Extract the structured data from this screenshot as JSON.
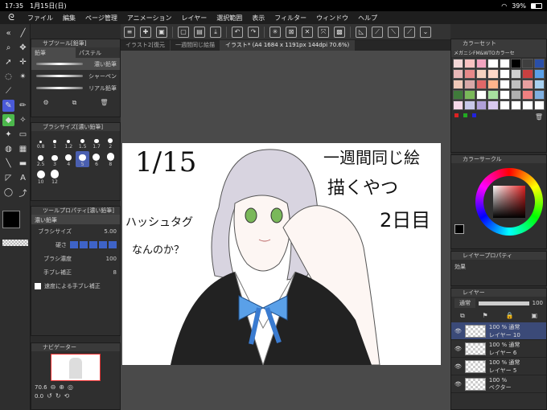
{
  "status_bar": {
    "time": "17:35",
    "date": "1月15日(日)",
    "battery": "39%"
  },
  "menu": {
    "items": [
      "ファイル",
      "編集",
      "ページ管理",
      "アニメーション",
      "レイヤー",
      "選択範囲",
      "表示",
      "フィルター",
      "ウィンドウ",
      "ヘルプ"
    ]
  },
  "tabs": [
    {
      "label": "イラスト2[復元"
    },
    {
      "label": "一週間同じ絵描"
    },
    {
      "label": "イラスト* (A4 1684 x 1191px 144dpi 70.6%)"
    }
  ],
  "subtool_panel": {
    "title": "サブツール[鉛筆]",
    "tab_pencil": "鉛筆",
    "tab_pastel": "パステル",
    "brushes": [
      "濃い鉛筆",
      "シャーペン",
      "リアル鉛筆"
    ]
  },
  "brush_size_panel": {
    "title": "ブラシサイズ[濃い鉛筆]",
    "sizes": [
      "0.8",
      "1",
      "1.2",
      "1.5",
      "1.7",
      "2",
      "2.5",
      "3",
      "4",
      "5",
      "6",
      "8",
      "10",
      "12"
    ]
  },
  "tool_property": {
    "title": "ツールプロパティ[濃い鉛筆]",
    "brush_name": "濃い鉛筆",
    "brush_size_label": "ブラシサイズ",
    "brush_size_value": "5.00",
    "hardness_label": "硬さ",
    "density_label": "ブラシ濃度",
    "density_value": "100",
    "stabilization_label": "手ブレ補正",
    "stabilization_value": "8",
    "speed_stabilization_label": "速度による手ブレ補正"
  },
  "navigator": {
    "title": "ナビゲーター",
    "zoom": "70.6",
    "rotation": "0.0"
  },
  "color_set": {
    "title": "カラーセット",
    "set_name": "メガニシFM&WTOカラーセ",
    "swatches": [
      "#f2d6d6",
      "#f8c2c2",
      "#f2a4c0",
      "#ffffff",
      "#ffffff",
      "#000000",
      "#3f3f3f",
      "#2a4fa8",
      "#e8b8b8",
      "#e88a8a",
      "#f5d2c0",
      "#ffd8c8",
      "#ffffff",
      "#d0d0d0",
      "#c84040",
      "#5aa0e8",
      "#f0c8b8",
      "#d8a8a8",
      "#e06868",
      "#ffb48c",
      "#ffffff",
      "#c0c0c0",
      "#e8a0a0",
      "#a8d0f0",
      "#3f7a3a",
      "#7ab85a",
      "#ffffff",
      "#a8e0a0",
      "#ffffff",
      "#b0b0b0",
      "#f08080",
      "#80b0e0",
      "#f5d8e8",
      "#c8c8e8",
      "#b0a0d8",
      "#d8c8f0",
      "#ffffff",
      "#ffffff",
      "#ffffff",
      "#ffffff"
    ]
  },
  "color_wheel": {
    "title": "カラーサークル"
  },
  "layer_property": {
    "title": "レイヤープロパティ",
    "effect_label": "効果"
  },
  "layers": {
    "title": "レイヤー",
    "blend": "通常",
    "opacity": "100",
    "items": [
      {
        "opacity": "100 %",
        "blend": "通常",
        "name": "レイヤー 10"
      },
      {
        "opacity": "100 %",
        "blend": "通常",
        "name": "レイヤー 6"
      },
      {
        "opacity": "100 %",
        "blend": "通常",
        "name": "レイヤー 5"
      },
      {
        "opacity": "100 %",
        "blend": "",
        "name": "ベクター"
      }
    ]
  },
  "canvas_text": {
    "date": "1/15",
    "line1": "一週間同じ絵",
    "line2": "描くやつ",
    "day": "2日目",
    "side1": "ハッシュタグ",
    "side2": "なんのか？"
  },
  "colors": {
    "accent": "#4a5ad8",
    "main_color": "#000000",
    "sub_color": "#ffffff"
  }
}
